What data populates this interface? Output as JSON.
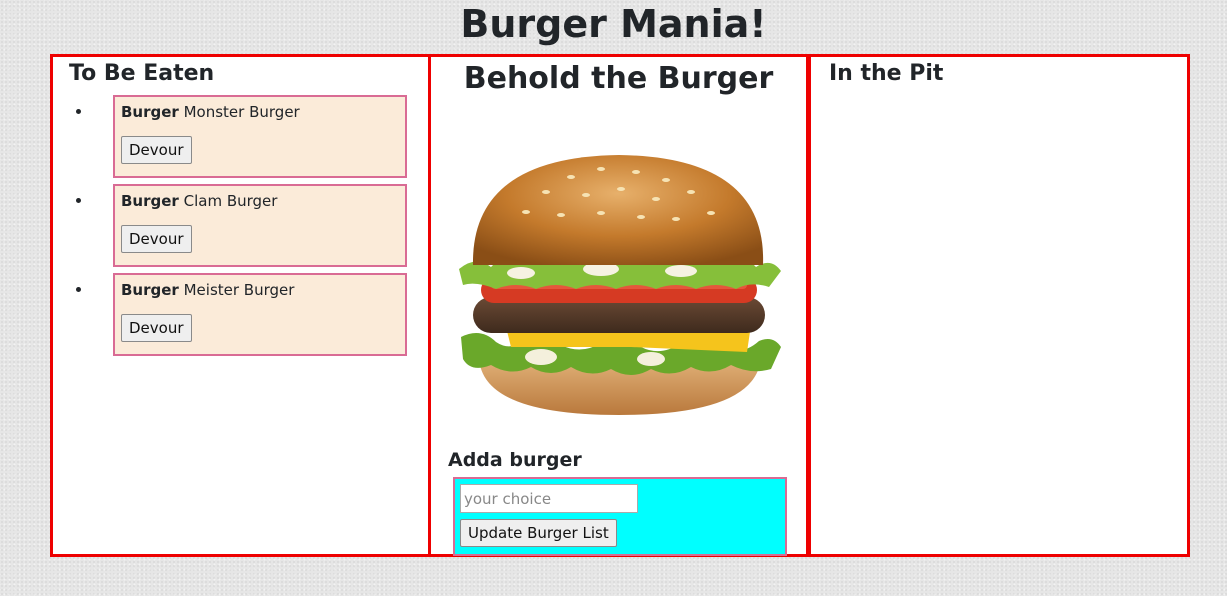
{
  "header": {
    "title": "Burger Mania!"
  },
  "left": {
    "heading": "To Be Eaten",
    "burgers": [
      {
        "kind": "Burger",
        "name": "Monster Burger",
        "button": "Devour"
      },
      {
        "kind": "Burger",
        "name": "Clam Burger",
        "button": "Devour"
      },
      {
        "kind": "Burger",
        "name": "Meister Burger",
        "button": "Devour"
      }
    ]
  },
  "middle": {
    "title": "Behold the Burger",
    "add_heading": "Adda burger",
    "input_placeholder": "your choice",
    "submit_label": "Update Burger List"
  },
  "right": {
    "heading": "In the Pit"
  },
  "colors": {
    "panel_border": "#ee0000",
    "card_bg": "#fbebd9",
    "card_border": "#d96b94",
    "form_bg": "#00ffff"
  }
}
